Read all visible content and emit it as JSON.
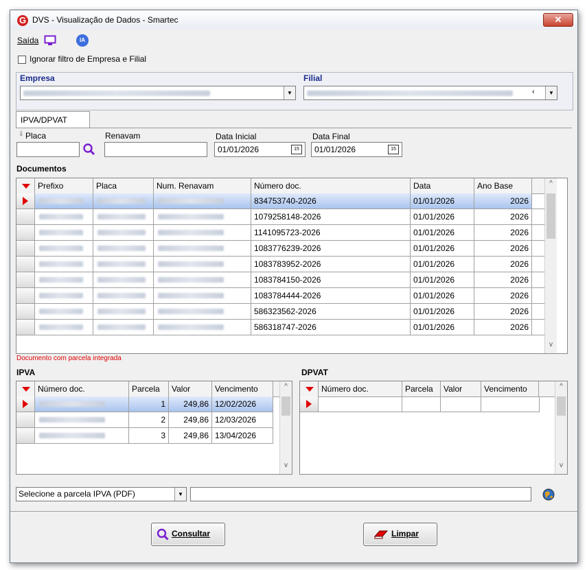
{
  "window": {
    "title": "DVS - Visualização de Dados - Smartec",
    "close": "✕",
    "logo": "G"
  },
  "menu": {
    "saida": "Saída",
    "ia": "IA"
  },
  "ignore_filter": {
    "label": "Ignorar filtro de Empresa e Filial",
    "checked": false
  },
  "empresa": {
    "label": "Empresa"
  },
  "filial": {
    "label": "Filial",
    "suffix": "‹"
  },
  "tab": {
    "label": "IPVA/DPVAT"
  },
  "filters": {
    "placa_label": "Placa",
    "renavam_label": "Renavam",
    "data_inicial_label": "Data Inicial",
    "data_inicial": "01/01/2026",
    "data_final_label": "Data Final",
    "data_final": "01/01/2026",
    "cal_icon": "15"
  },
  "documentos": {
    "label": "Documentos",
    "columns": [
      "Prefixo",
      "Placa",
      "Num. Renavam",
      "Número doc.",
      "Data",
      "Ano Base"
    ],
    "rows": [
      {
        "num_doc": "834753740-2026",
        "data": "01/01/2026",
        "ano": "2026"
      },
      {
        "num_doc": "1079258148-2026",
        "data": "01/01/2026",
        "ano": "2026"
      },
      {
        "num_doc": "1141095723-2026",
        "data": "01/01/2026",
        "ano": "2026"
      },
      {
        "num_doc": "1083776239-2026",
        "data": "01/01/2026",
        "ano": "2026"
      },
      {
        "num_doc": "1083783952-2026",
        "data": "01/01/2026",
        "ano": "2026"
      },
      {
        "num_doc": "1083784150-2026",
        "data": "01/01/2026",
        "ano": "2026"
      },
      {
        "num_doc": "1083784444-2026",
        "data": "01/01/2026",
        "ano": "2026"
      },
      {
        "num_doc": "586323562-2026",
        "data": "01/01/2026",
        "ano": "2026"
      },
      {
        "num_doc": "586318747-2026",
        "data": "01/01/2026",
        "ano": "2026"
      }
    ]
  },
  "note": "Documento com parcela integrada",
  "ipva": {
    "label": "IPVA",
    "columns": [
      "Número doc.",
      "Parcela",
      "Valor",
      "Vencimento"
    ],
    "rows": [
      {
        "parcela": "1",
        "valor": "249,86",
        "venc": "12/02/2026"
      },
      {
        "parcela": "2",
        "valor": "249,86",
        "venc": "12/03/2026"
      },
      {
        "parcela": "3",
        "valor": "249,86",
        "venc": "13/04/2026"
      }
    ]
  },
  "dpvat": {
    "label": "DPVAT",
    "columns": [
      "Número doc.",
      "Parcela",
      "Valor",
      "Vencimento"
    ]
  },
  "pdf_select": {
    "value": "Selecione a parcela IPVA (PDF)"
  },
  "buttons": {
    "consultar": "Consultar",
    "limpar": "Limpar"
  },
  "colors": {
    "accent_blue": "#1a2b8c",
    "indicator_red": "#e00000",
    "note_red": "#e00000",
    "selection": "#a9c4ee"
  }
}
